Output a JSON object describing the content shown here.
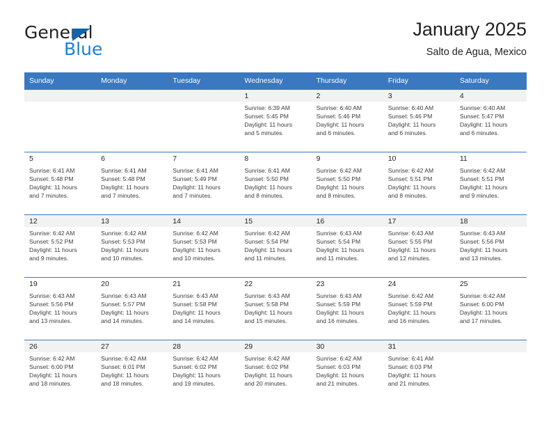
{
  "brand": {
    "name_part1": "General",
    "name_part2": "Blue",
    "logo_icon": "blue-triangle-icon"
  },
  "header": {
    "title": "January 2025",
    "subtitle": "Salto de Agua, Mexico"
  },
  "colors": {
    "header_blue": "#3a78bf",
    "brand_dark": "#231f20",
    "brand_blue": "#1b7fd4",
    "row_shade": "#f2f2f2",
    "text": "#3d3d3d"
  },
  "weekday_headers": [
    "Sunday",
    "Monday",
    "Tuesday",
    "Wednesday",
    "Thursday",
    "Friday",
    "Saturday"
  ],
  "labels": {
    "sunrise": "Sunrise:",
    "sunset": "Sunset:",
    "daylight": "Daylight:"
  },
  "weeks": [
    {
      "days": [
        {
          "num": "",
          "empty": true
        },
        {
          "num": "",
          "empty": true
        },
        {
          "num": "",
          "empty": true
        },
        {
          "num": "1",
          "sunrise": "Sunrise: 6:39 AM",
          "sunset": "Sunset: 5:45 PM",
          "daylight_l1": "Daylight: 11 hours",
          "daylight_l2": "and 5 minutes."
        },
        {
          "num": "2",
          "sunrise": "Sunrise: 6:40 AM",
          "sunset": "Sunset: 5:46 PM",
          "daylight_l1": "Daylight: 11 hours",
          "daylight_l2": "and 6 minutes."
        },
        {
          "num": "3",
          "sunrise": "Sunrise: 6:40 AM",
          "sunset": "Sunset: 5:46 PM",
          "daylight_l1": "Daylight: 11 hours",
          "daylight_l2": "and 6 minutes."
        },
        {
          "num": "4",
          "sunrise": "Sunrise: 6:40 AM",
          "sunset": "Sunset: 5:47 PM",
          "daylight_l1": "Daylight: 11 hours",
          "daylight_l2": "and 6 minutes."
        }
      ]
    },
    {
      "days": [
        {
          "num": "5",
          "sunrise": "Sunrise: 6:41 AM",
          "sunset": "Sunset: 5:48 PM",
          "daylight_l1": "Daylight: 11 hours",
          "daylight_l2": "and 7 minutes."
        },
        {
          "num": "6",
          "sunrise": "Sunrise: 6:41 AM",
          "sunset": "Sunset: 5:48 PM",
          "daylight_l1": "Daylight: 11 hours",
          "daylight_l2": "and 7 minutes."
        },
        {
          "num": "7",
          "sunrise": "Sunrise: 6:41 AM",
          "sunset": "Sunset: 5:49 PM",
          "daylight_l1": "Daylight: 11 hours",
          "daylight_l2": "and 7 minutes."
        },
        {
          "num": "8",
          "sunrise": "Sunrise: 6:41 AM",
          "sunset": "Sunset: 5:50 PM",
          "daylight_l1": "Daylight: 11 hours",
          "daylight_l2": "and 8 minutes."
        },
        {
          "num": "9",
          "sunrise": "Sunrise: 6:42 AM",
          "sunset": "Sunset: 5:50 PM",
          "daylight_l1": "Daylight: 11 hours",
          "daylight_l2": "and 8 minutes."
        },
        {
          "num": "10",
          "sunrise": "Sunrise: 6:42 AM",
          "sunset": "Sunset: 5:51 PM",
          "daylight_l1": "Daylight: 11 hours",
          "daylight_l2": "and 8 minutes."
        },
        {
          "num": "11",
          "sunrise": "Sunrise: 6:42 AM",
          "sunset": "Sunset: 5:51 PM",
          "daylight_l1": "Daylight: 11 hours",
          "daylight_l2": "and 9 minutes."
        }
      ]
    },
    {
      "days": [
        {
          "num": "12",
          "sunrise": "Sunrise: 6:42 AM",
          "sunset": "Sunset: 5:52 PM",
          "daylight_l1": "Daylight: 11 hours",
          "daylight_l2": "and 9 minutes."
        },
        {
          "num": "13",
          "sunrise": "Sunrise: 6:42 AM",
          "sunset": "Sunset: 5:53 PM",
          "daylight_l1": "Daylight: 11 hours",
          "daylight_l2": "and 10 minutes."
        },
        {
          "num": "14",
          "sunrise": "Sunrise: 6:42 AM",
          "sunset": "Sunset: 5:53 PM",
          "daylight_l1": "Daylight: 11 hours",
          "daylight_l2": "and 10 minutes."
        },
        {
          "num": "15",
          "sunrise": "Sunrise: 6:42 AM",
          "sunset": "Sunset: 5:54 PM",
          "daylight_l1": "Daylight: 11 hours",
          "daylight_l2": "and 11 minutes."
        },
        {
          "num": "16",
          "sunrise": "Sunrise: 6:43 AM",
          "sunset": "Sunset: 5:54 PM",
          "daylight_l1": "Daylight: 11 hours",
          "daylight_l2": "and 11 minutes."
        },
        {
          "num": "17",
          "sunrise": "Sunrise: 6:43 AM",
          "sunset": "Sunset: 5:55 PM",
          "daylight_l1": "Daylight: 11 hours",
          "daylight_l2": "and 12 minutes."
        },
        {
          "num": "18",
          "sunrise": "Sunrise: 6:43 AM",
          "sunset": "Sunset: 5:56 PM",
          "daylight_l1": "Daylight: 11 hours",
          "daylight_l2": "and 13 minutes."
        }
      ]
    },
    {
      "days": [
        {
          "num": "19",
          "sunrise": "Sunrise: 6:43 AM",
          "sunset": "Sunset: 5:56 PM",
          "daylight_l1": "Daylight: 11 hours",
          "daylight_l2": "and 13 minutes."
        },
        {
          "num": "20",
          "sunrise": "Sunrise: 6:43 AM",
          "sunset": "Sunset: 5:57 PM",
          "daylight_l1": "Daylight: 11 hours",
          "daylight_l2": "and 14 minutes."
        },
        {
          "num": "21",
          "sunrise": "Sunrise: 6:43 AM",
          "sunset": "Sunset: 5:58 PM",
          "daylight_l1": "Daylight: 11 hours",
          "daylight_l2": "and 14 minutes."
        },
        {
          "num": "22",
          "sunrise": "Sunrise: 6:43 AM",
          "sunset": "Sunset: 5:58 PM",
          "daylight_l1": "Daylight: 11 hours",
          "daylight_l2": "and 15 minutes."
        },
        {
          "num": "23",
          "sunrise": "Sunrise: 6:43 AM",
          "sunset": "Sunset: 5:59 PM",
          "daylight_l1": "Daylight: 11 hours",
          "daylight_l2": "and 16 minutes."
        },
        {
          "num": "24",
          "sunrise": "Sunrise: 6:42 AM",
          "sunset": "Sunset: 5:59 PM",
          "daylight_l1": "Daylight: 11 hours",
          "daylight_l2": "and 16 minutes."
        },
        {
          "num": "25",
          "sunrise": "Sunrise: 6:42 AM",
          "sunset": "Sunset: 6:00 PM",
          "daylight_l1": "Daylight: 11 hours",
          "daylight_l2": "and 17 minutes."
        }
      ]
    },
    {
      "days": [
        {
          "num": "26",
          "sunrise": "Sunrise: 6:42 AM",
          "sunset": "Sunset: 6:00 PM",
          "daylight_l1": "Daylight: 11 hours",
          "daylight_l2": "and 18 minutes."
        },
        {
          "num": "27",
          "sunrise": "Sunrise: 6:42 AM",
          "sunset": "Sunset: 6:01 PM",
          "daylight_l1": "Daylight: 11 hours",
          "daylight_l2": "and 18 minutes."
        },
        {
          "num": "28",
          "sunrise": "Sunrise: 6:42 AM",
          "sunset": "Sunset: 6:02 PM",
          "daylight_l1": "Daylight: 11 hours",
          "daylight_l2": "and 19 minutes."
        },
        {
          "num": "29",
          "sunrise": "Sunrise: 6:42 AM",
          "sunset": "Sunset: 6:02 PM",
          "daylight_l1": "Daylight: 11 hours",
          "daylight_l2": "and 20 minutes."
        },
        {
          "num": "30",
          "sunrise": "Sunrise: 6:42 AM",
          "sunset": "Sunset: 6:03 PM",
          "daylight_l1": "Daylight: 11 hours",
          "daylight_l2": "and 21 minutes."
        },
        {
          "num": "31",
          "sunrise": "Sunrise: 6:41 AM",
          "sunset": "Sunset: 6:03 PM",
          "daylight_l1": "Daylight: 11 hours",
          "daylight_l2": "and 21 minutes."
        },
        {
          "num": "",
          "empty": true
        }
      ]
    }
  ]
}
